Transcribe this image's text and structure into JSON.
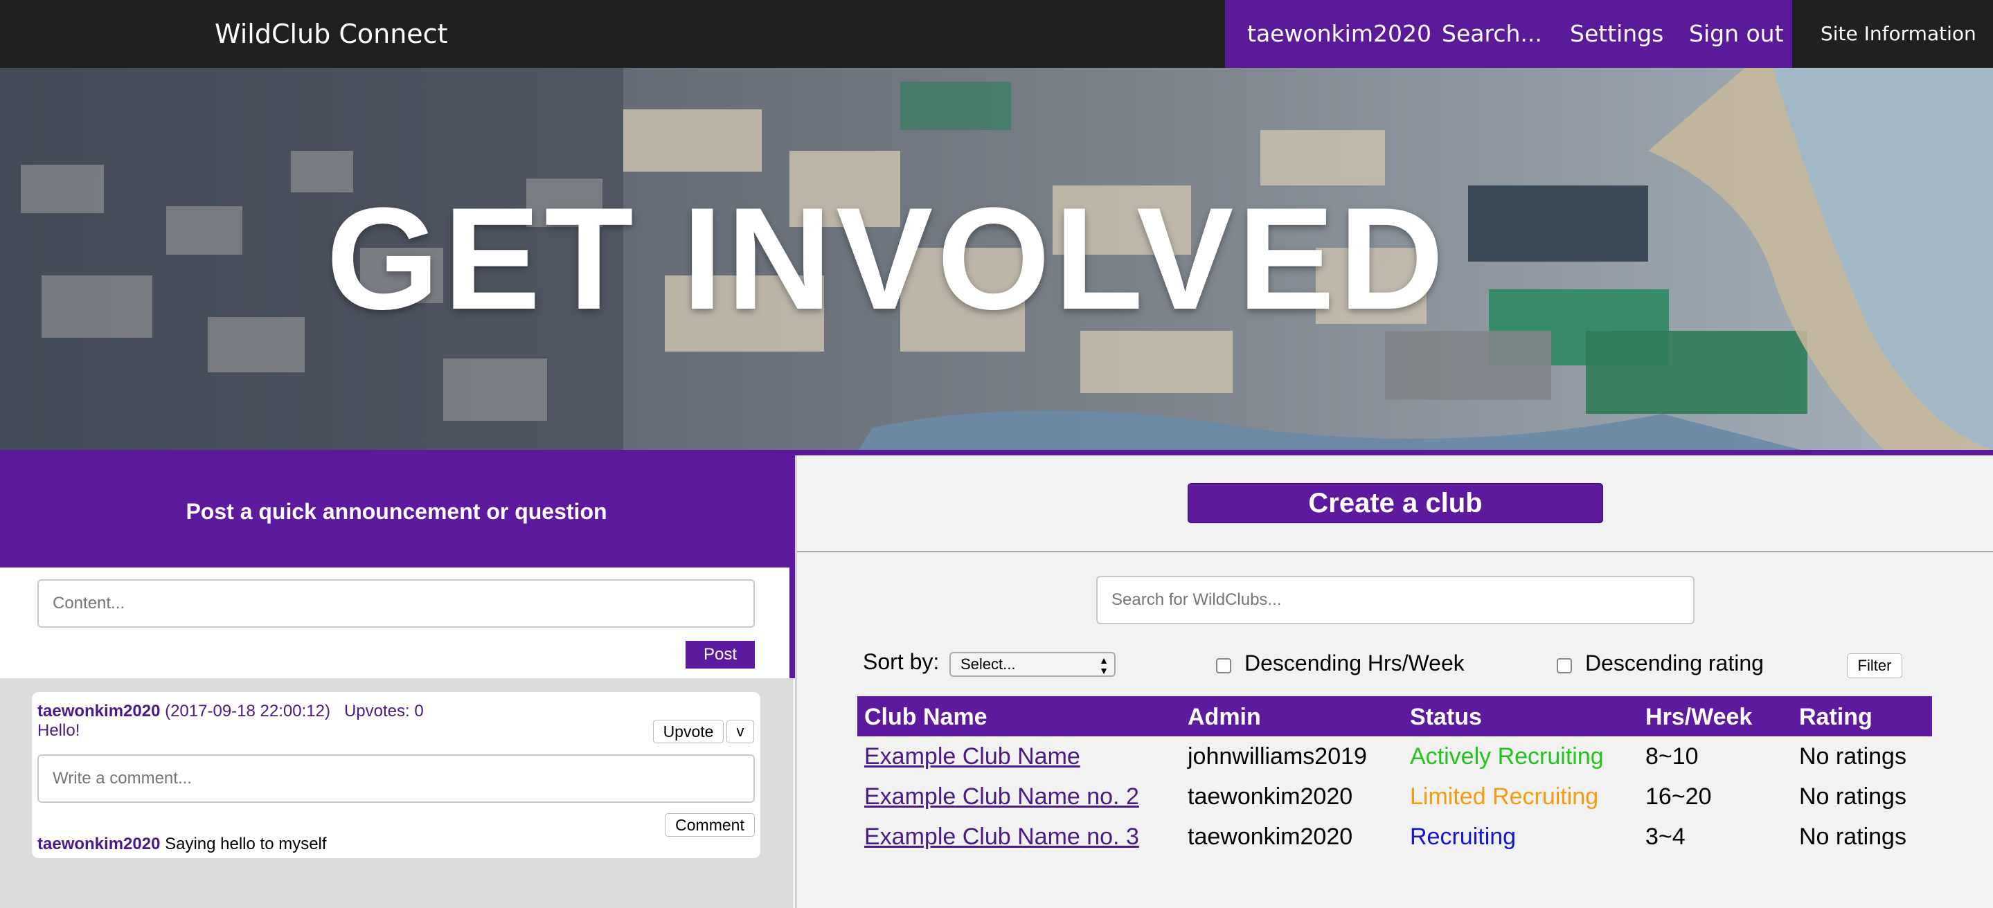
{
  "navbar": {
    "brand": "WildClub Connect",
    "user": "taewonkim2020",
    "search": "Search...",
    "settings": "Settings",
    "sign_out": "Sign out",
    "site_info": "Site Information"
  },
  "hero": {
    "title": "GET INVOLVED"
  },
  "announcement": {
    "title": "Post a quick announcement or question",
    "content_placeholder": "Content...",
    "post_label": "Post"
  },
  "post": {
    "author": "taewonkim2020",
    "timestamp": "(2017-09-18 22:00:12)",
    "upvotes": "Upvotes: 0",
    "body": "Hello!",
    "upvote_label": "Upvote",
    "downvote_label": "v",
    "comment_placeholder": "Write a comment...",
    "comment_label": "Comment",
    "comments": [
      {
        "author": "taewonkim2020",
        "text": "Saying hello to myself"
      }
    ]
  },
  "clubs": {
    "create_label": "Create a club",
    "search_placeholder": "Search for WildClubs...",
    "sort_label": "Sort by:",
    "sort_selected": "Select...",
    "desc_hours_label": "Descending Hrs/Week",
    "desc_rating_label": "Descending rating",
    "filter_label": "Filter",
    "columns": [
      "Club Name",
      "Admin",
      "Status",
      "Hrs/Week",
      "Rating"
    ],
    "rows": [
      {
        "name": "Example Club Name",
        "admin": "johnwilliams2019",
        "status": "Actively Recruiting",
        "hours": "8~10",
        "rating": "No ratings"
      },
      {
        "name": "Example Club Name no. 2",
        "admin": "taewonkim2020",
        "status": "Limited Recruiting",
        "hours": "16~20",
        "rating": "No ratings"
      },
      {
        "name": "Example Club Name no. 3",
        "admin": "taewonkim2020",
        "status": "Recruiting",
        "hours": "3~4",
        "rating": "No ratings"
      }
    ]
  },
  "colors": {
    "purple": "#5e1a9e",
    "navbar": "#202020",
    "status_active": "#22c41c",
    "status_limited": "#f39c12",
    "status_recruiting": "#1414d8"
  }
}
